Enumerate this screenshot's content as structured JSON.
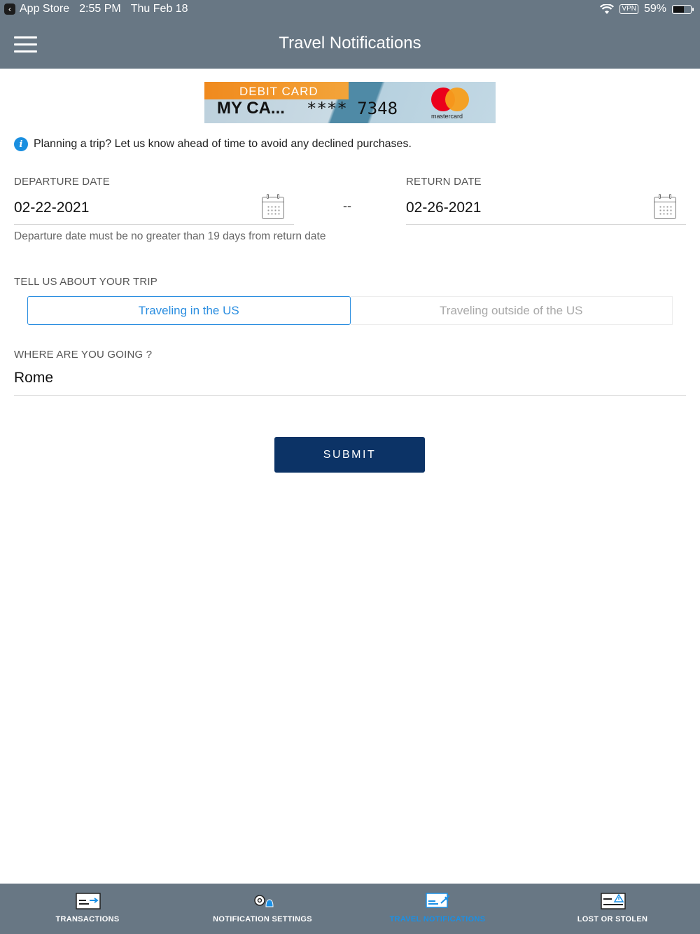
{
  "status_bar": {
    "back_app": "App Store",
    "time": "2:55 PM",
    "date": "Thu Feb 18",
    "vpn": "VPN",
    "battery": "59%"
  },
  "header": {
    "title": "Travel Notifications",
    "menu_icon": "hamburger-menu-icon"
  },
  "card": {
    "type": "DEBIT CARD",
    "name": "MY CA...",
    "number": "**** 7348",
    "brand": "mastercard"
  },
  "info": {
    "icon": "info-icon",
    "text": "Planning a trip? Let us know ahead of time to avoid any declined purchases."
  },
  "dates": {
    "departure_label": "DEPARTURE DATE",
    "departure_value": "02-22-2021",
    "separator": "--",
    "return_label": "RETURN DATE",
    "return_value": "02-26-2021",
    "hint": "Departure date must be no greater than 19 days from return date"
  },
  "trip": {
    "label": "TELL US ABOUT YOUR TRIP",
    "options": [
      "Traveling in the US",
      "Traveling outside of the US"
    ],
    "selected": "Traveling in the US"
  },
  "destination": {
    "label": "WHERE ARE YOU GOING ?",
    "value": "Rome"
  },
  "submit_label": "SUBMIT",
  "bottom_nav": {
    "items": [
      {
        "label": "TRANSACTIONS",
        "icon": "transactions-icon"
      },
      {
        "label": "NOTIFICATION SETTINGS",
        "icon": "notification-settings-icon"
      },
      {
        "label": "TRAVEL NOTIFICATIONS",
        "icon": "travel-notifications-icon"
      },
      {
        "label": "LOST OR STOLEN",
        "icon": "lost-or-stolen-icon"
      }
    ],
    "active": "TRAVEL NOTIFICATIONS"
  },
  "colors": {
    "header_bg": "#687784",
    "accent": "#2b8ee0",
    "submit_bg": "#0c3366"
  }
}
